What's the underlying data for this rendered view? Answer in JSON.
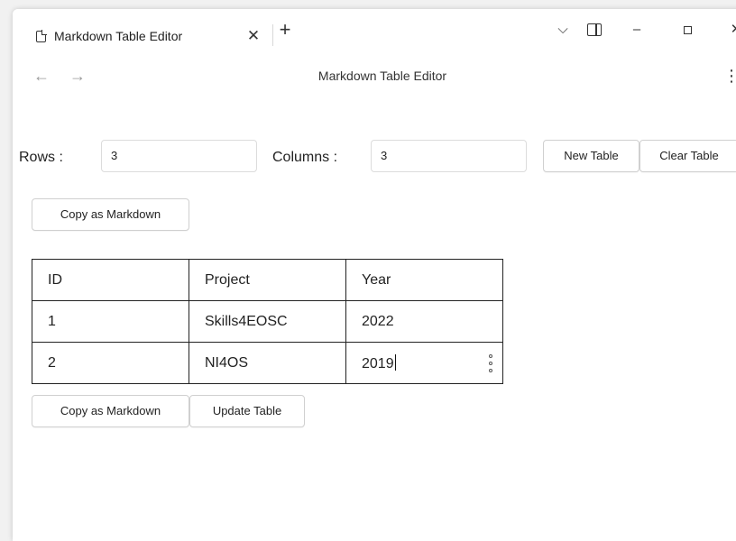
{
  "browser": {
    "tab_title": "Markdown Table Editor",
    "tab_close": "✕",
    "new_tab": "+",
    "tab_list_icon": "⌵",
    "minimize_icon": "–",
    "close_icon": "✕",
    "back_icon": "←",
    "forward_icon": "→",
    "menu_icon": "⋮",
    "page_title": "Markdown Table Editor"
  },
  "controls": {
    "rows_label": "Rows :",
    "rows_value": "3",
    "columns_label": "Columns :",
    "columns_value": "3",
    "new_table_label": "New Table",
    "clear_table_label": "Clear Table",
    "copy_markdown_top_label": "Copy as Markdown",
    "copy_markdown_bottom_label": "Copy as Markdown",
    "update_table_label": "Update Table"
  },
  "table": {
    "rows": [
      [
        "ID",
        "Project",
        "Year"
      ],
      [
        "1",
        "Skills4EOSC",
        "2022"
      ],
      [
        "2",
        "NI4OS",
        "2019"
      ]
    ]
  }
}
